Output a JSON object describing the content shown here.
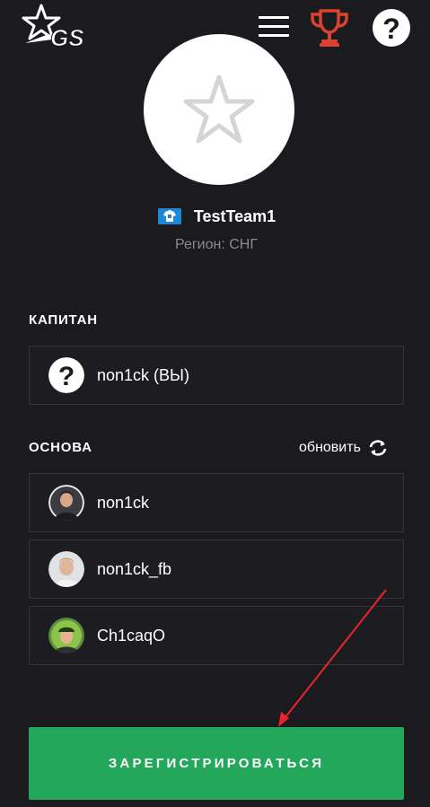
{
  "header": {
    "logo_text": "GS",
    "menu_icon": "hamburger-menu-icon",
    "trophy_icon": "trophy-icon",
    "help_icon": "question-icon"
  },
  "team": {
    "name": "TestTeam1",
    "region": "Регион: СНГ",
    "avatar_icon": "star-outline-icon",
    "flag_icon": "team-flag-icon"
  },
  "captain": {
    "title": "КАПИТАН",
    "name": "non1ck (ВЫ)",
    "avatar_icon": "question-icon"
  },
  "roster": {
    "title": "ОСНОВА",
    "refresh_label": "обновить",
    "refresh_icon": "refresh-icon",
    "players": [
      {
        "name": "non1ck"
      },
      {
        "name": "non1ck_fb"
      },
      {
        "name": "Ch1caqO"
      }
    ]
  },
  "register_button": {
    "label": "ЗАРЕГИСТРИРОВАТЬСЯ"
  },
  "colors": {
    "background": "#1b1b1f",
    "accent_green": "#23a75a",
    "trophy_red": "#d9432f",
    "annotation_red": "#e8252b",
    "muted_text": "#8a8a92"
  }
}
